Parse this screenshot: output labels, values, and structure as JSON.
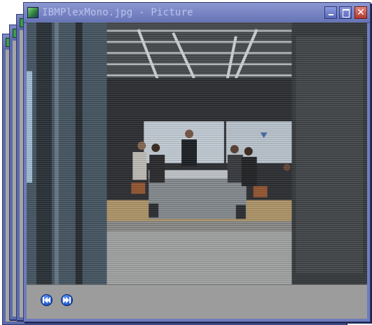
{
  "window": {
    "title": "IBMPlexMono.jpg - Picture",
    "app_icon": "picture-app-icon",
    "controls": {
      "minimize_icon": "minimize-icon",
      "maximize_icon": "maximize-icon",
      "close_icon": "close-icon",
      "close_glyph": "✕"
    }
  },
  "viewer": {
    "image_name": "IBMPlexMono.jpg",
    "image_subject": "photo",
    "prev_icon": "previous-icon",
    "next_icon": "next-icon"
  },
  "colors": {
    "titlebar": "#7583c0",
    "title_text": "#b9c3ef",
    "close_button": "#c84a3e",
    "nav_button": "#2d67e0",
    "controls_bg": "#9c9c9c"
  }
}
